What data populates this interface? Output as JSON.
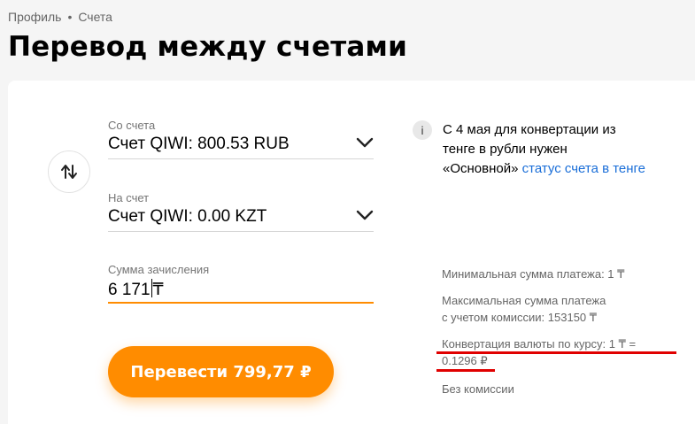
{
  "breadcrumb": {
    "items": [
      "Профиль",
      "Счета"
    ],
    "separator": "•"
  },
  "page": {
    "title": "Перевод между счетами"
  },
  "form": {
    "from": {
      "label": "Со счета",
      "value": "Счет QIWI: 800.53 RUB"
    },
    "to": {
      "label": "На счет",
      "value": "Счет QIWI: 0.00 KZT"
    },
    "amount": {
      "label": "Сумма зачисления",
      "value_before_caret": "6 171",
      "value_after_caret": "₸"
    },
    "submit_label": "Перевести 799,77 ₽"
  },
  "info": {
    "icon": "info-icon",
    "text": "С 4 мая для конвертации из тенге в рубли нужен «Основной» ",
    "link": "статус счета в тенге"
  },
  "facts": {
    "min": "Минимальная сумма платежа: 1 ₸",
    "max_line1": "Максимальная сумма платежа",
    "max_line2": "с учетом комиссии: 153150 ₸",
    "rate_line1": "Конвертация валюты по курсу: 1 ₸ =",
    "rate_line2": "0.1296 ₽",
    "fee": "Без комиссии"
  },
  "colors": {
    "accent": "#ff8c00",
    "link": "#1a6ed8",
    "annotation_red": "#e00000"
  }
}
